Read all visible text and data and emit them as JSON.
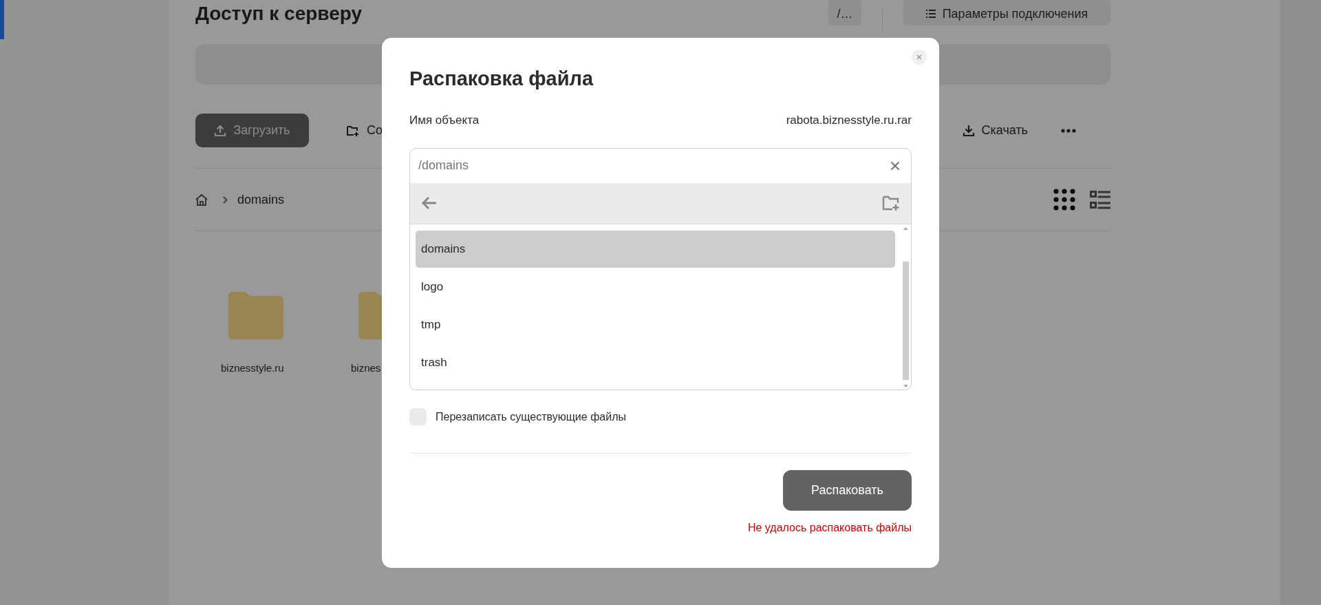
{
  "page": {
    "title": "Доступ к серверу",
    "header_buttons": [
      {
        "kind": "path",
        "label": "/…"
      },
      {
        "kind": "settings",
        "label": "Параметры подключения"
      }
    ],
    "toolbar": [
      {
        "kind": "upload",
        "label": "Загрузить"
      },
      {
        "kind": "new-folder",
        "label": "Со"
      },
      {
        "kind": "download",
        "label": "Скачать"
      },
      {
        "kind": "more"
      }
    ],
    "breadcrumb": [
      "domains"
    ],
    "view_modes": [
      {
        "kind": "grid",
        "selected": true
      },
      {
        "kind": "list",
        "selected": false
      }
    ],
    "files": [
      {
        "name": "biznesstyle.ru"
      },
      {
        "name": "biznes"
      }
    ]
  },
  "dialog": {
    "title": "Распаковка файла",
    "object_label": "Имя объекта",
    "object_name": "rabota.biznesstyle.ru.rar",
    "path_value": "/domains",
    "folders": [
      {
        "name": "domains",
        "selected": true
      },
      {
        "name": "logo",
        "selected": false
      },
      {
        "name": "tmp",
        "selected": false
      },
      {
        "name": "trash",
        "selected": false
      }
    ],
    "overwrite": {
      "label": "Перезаписать существующие файлы",
      "checked": false
    },
    "submit": "Распаковать",
    "error": "Не удалось распаковать файлы"
  }
}
